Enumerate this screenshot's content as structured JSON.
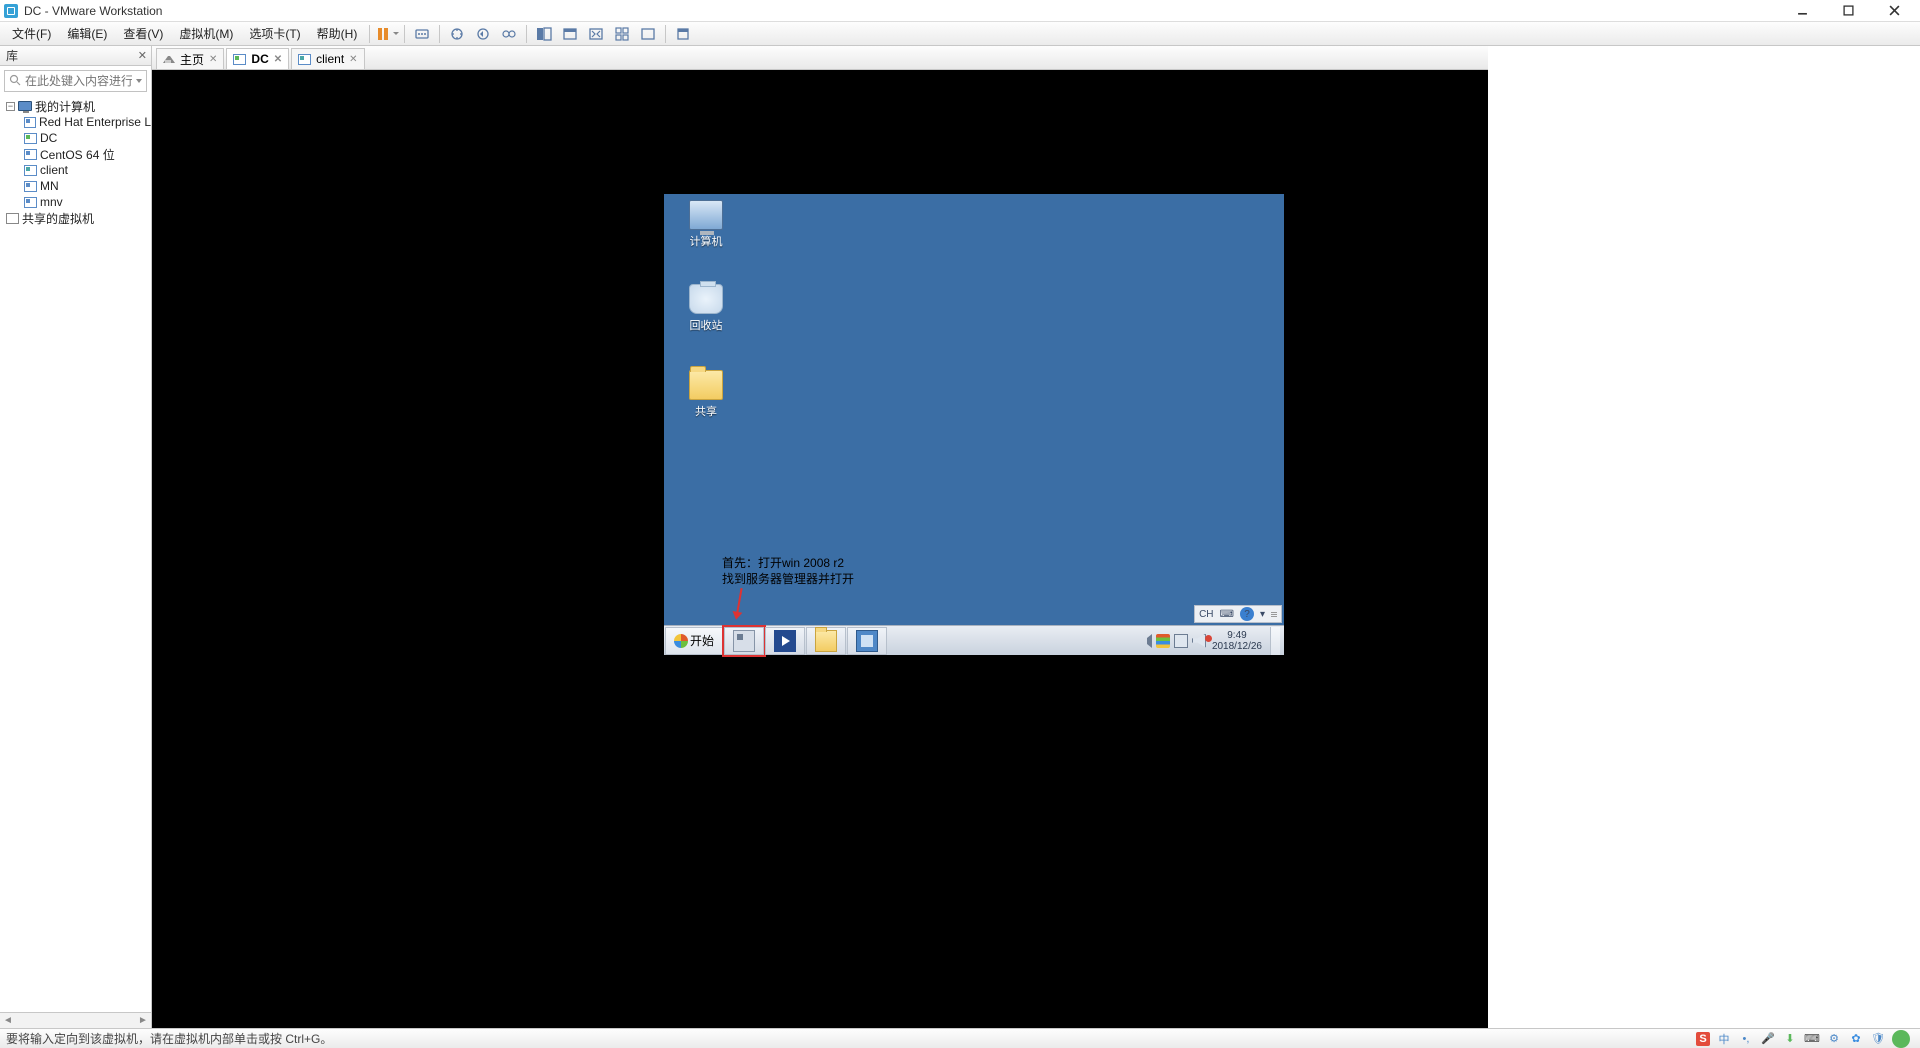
{
  "titlebar": {
    "title": "DC - VMware Workstation"
  },
  "menu": {
    "file": "文件(F)",
    "edit": "编辑(E)",
    "view": "查看(V)",
    "vm": "虚拟机(M)",
    "tabs": "选项卡(T)",
    "help": "帮助(H)"
  },
  "sidebar": {
    "header": "库",
    "search_placeholder": "在此处键入内容进行...",
    "root": "我的计算机",
    "items": [
      {
        "label": "Red Hat Enterprise L"
      },
      {
        "label": "DC"
      },
      {
        "label": "CentOS 64 位"
      },
      {
        "label": "client"
      },
      {
        "label": "MN"
      },
      {
        "label": "mnv"
      }
    ],
    "shared": "共享的虚拟机"
  },
  "tabs": {
    "home": "主页",
    "dc": "DC",
    "client": "client"
  },
  "guest": {
    "desktop": {
      "computer": "计算机",
      "recycle": "回收站",
      "share": "共享"
    },
    "annotation": {
      "line1": "首先：打开win 2008 r2",
      "line2": "找到服务器管理器并打开"
    },
    "langbar": {
      "ch": "CH",
      "help": "?"
    },
    "taskbar": {
      "start": "开始",
      "clock_time": "9:49",
      "clock_date": "2018/12/26"
    }
  },
  "statusbar": {
    "message": "要将输入定向到该虚拟机，请在虚拟机内部单击或按 Ctrl+G。"
  },
  "host_tray": {
    "ime": "中"
  }
}
